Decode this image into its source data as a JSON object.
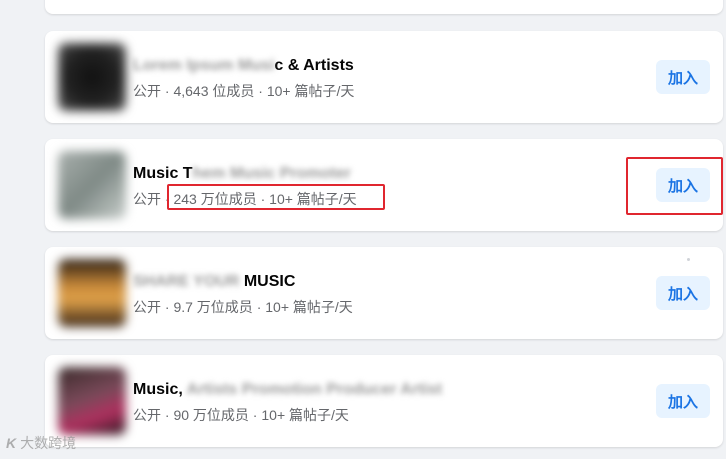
{
  "groups": [
    {
      "name_hidden": "Lorem Ipsum Musi",
      "name_visible": "c & Artists",
      "privacy": "公开",
      "members": "4,643 位成员",
      "posts": "10+ 篇帖子/天",
      "join_label": "加入"
    },
    {
      "name_visible": "Music T",
      "name_hidden": "hem Music Promoter",
      "privacy": "公开",
      "members": "243 万位成员",
      "posts": "10+ 篇帖子/天",
      "join_label": "加入"
    },
    {
      "name_hidden": "SHARE YOUR",
      "name_visible": "MUSIC",
      "privacy": "公开",
      "members": "9.7 万位成员",
      "posts": "10+ 篇帖子/天",
      "join_label": "加入"
    },
    {
      "name_visible": "Music,",
      "name_hidden": " Artists Promotion Producer Artist",
      "privacy": "公开",
      "members": "90 万位成员",
      "posts": "10+ 篇帖子/天",
      "join_label": "加入"
    }
  ],
  "separator": " · ",
  "watermark": {
    "logo": "K",
    "text": "大数跨境"
  },
  "colors": {
    "page_bg": "#f0f2f5",
    "button_bg": "#e7f3ff",
    "button_text": "#1b74e4",
    "highlight": "#e0262f"
  }
}
